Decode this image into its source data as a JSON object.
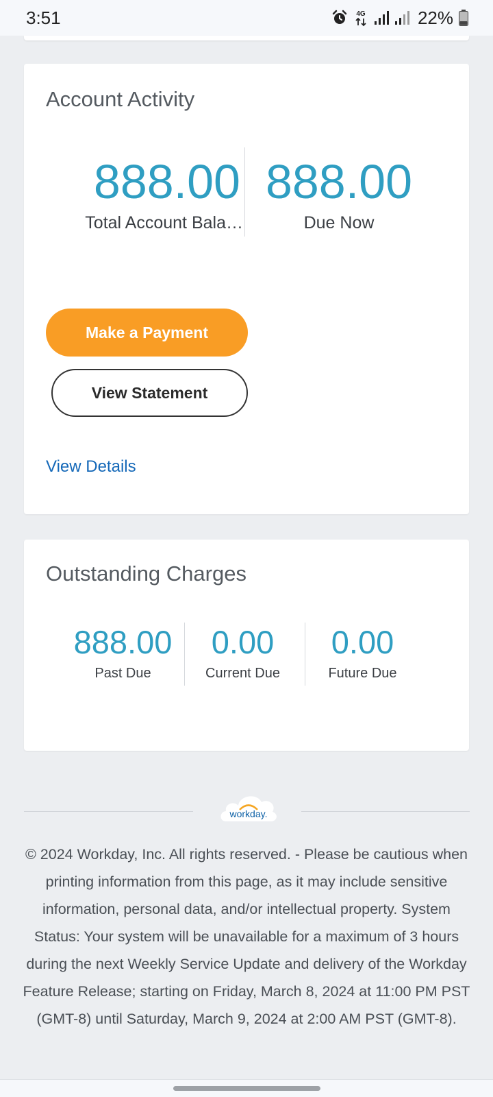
{
  "status_bar": {
    "time": "3:51",
    "network": "4G",
    "battery": "22%",
    "icons": [
      "alarm-icon",
      "data-4g-icon",
      "signal-icon",
      "signal-icon-secondary",
      "battery-icon"
    ]
  },
  "account_activity": {
    "title": "Account Activity",
    "total_balance": {
      "value": "888.00",
      "label": "Total Account Bala…"
    },
    "due_now": {
      "value": "888.00",
      "label": "Due Now"
    },
    "make_payment_label": "Make a Payment",
    "view_statement_label": "View Statement",
    "view_details_label": "View Details",
    "colors": {
      "accent": "#2f9ec2",
      "primary_button": "#f99d25",
      "link": "#1468b8"
    }
  },
  "outstanding_charges": {
    "title": "Outstanding Charges",
    "items": [
      {
        "value": "888.00",
        "label": "Past Due"
      },
      {
        "value": "0.00",
        "label": "Current Due"
      },
      {
        "value": "0.00",
        "label": "Future Due"
      }
    ]
  },
  "footer": {
    "logo_text": "workday.",
    "text": "© 2024 Workday, Inc. All rights reserved. - Please be cautious when printing information from this page, as it may include sensitive information, personal data, and/or intellectual property. System Status: Your system will be unavailable for a maximum of 3 hours during the next Weekly Service Update and delivery of the Workday Feature Release; starting on Friday, March 8, 2024 at 11:00 PM PST (GMT-8) until Saturday, March 9, 2024 at 2:00 AM PST (GMT-8)."
  }
}
